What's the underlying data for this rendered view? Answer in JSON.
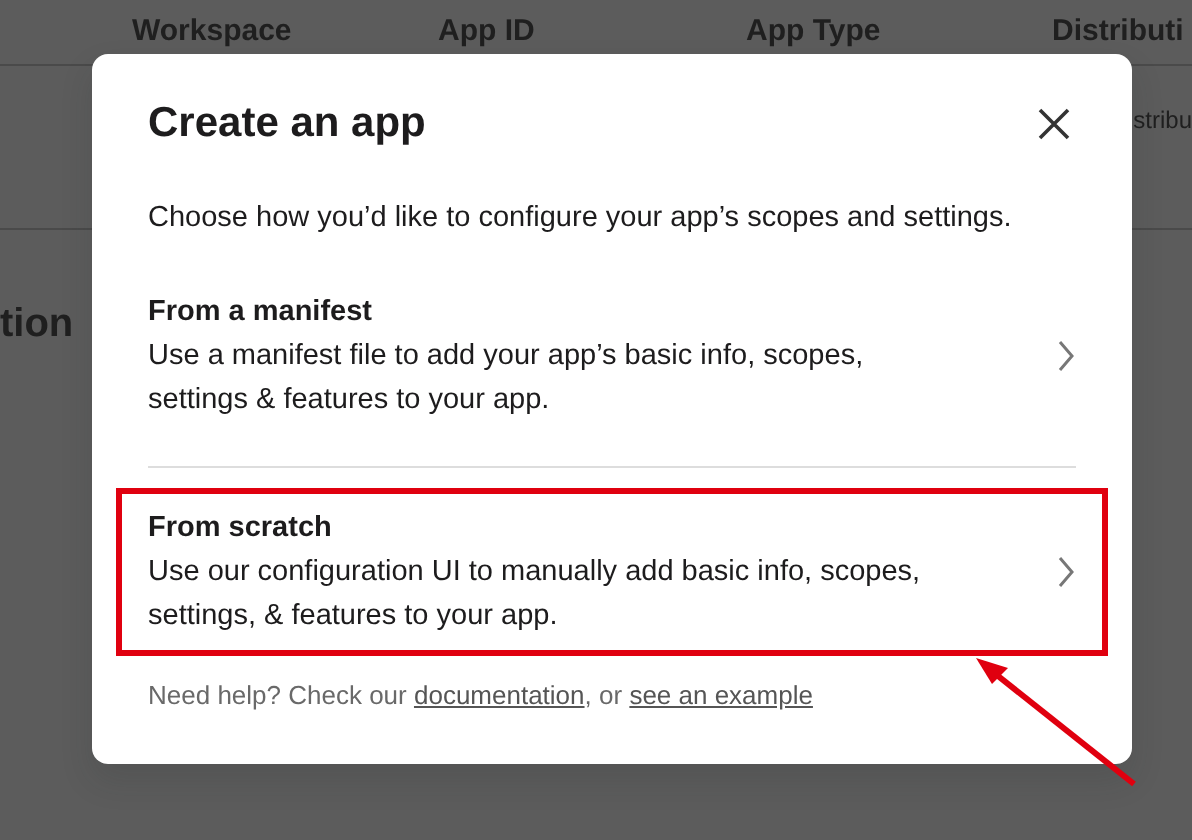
{
  "background_page": {
    "table_columns": [
      "Workspace",
      "App ID",
      "App Type",
      "Distributi"
    ],
    "row_fragment": "stribu",
    "heading_fragment": "tion"
  },
  "dialog": {
    "title": "Create an app",
    "description": "Choose how you’d like to configure your app’s scopes and settings.",
    "options": [
      {
        "title": "From a manifest",
        "description": "Use a manifest file to add your app’s basic info, scopes, settings & features to your app.",
        "highlighted": false
      },
      {
        "title": "From scratch",
        "description": "Use our configuration UI to manually add basic info, scopes, settings, & features to your app.",
        "highlighted": true
      }
    ],
    "help": {
      "text": "Need help? Check our",
      "link_1": "documentation",
      "separator": ", or",
      "link_2": "see an example"
    }
  },
  "annotation": {
    "kind": "arrow"
  }
}
